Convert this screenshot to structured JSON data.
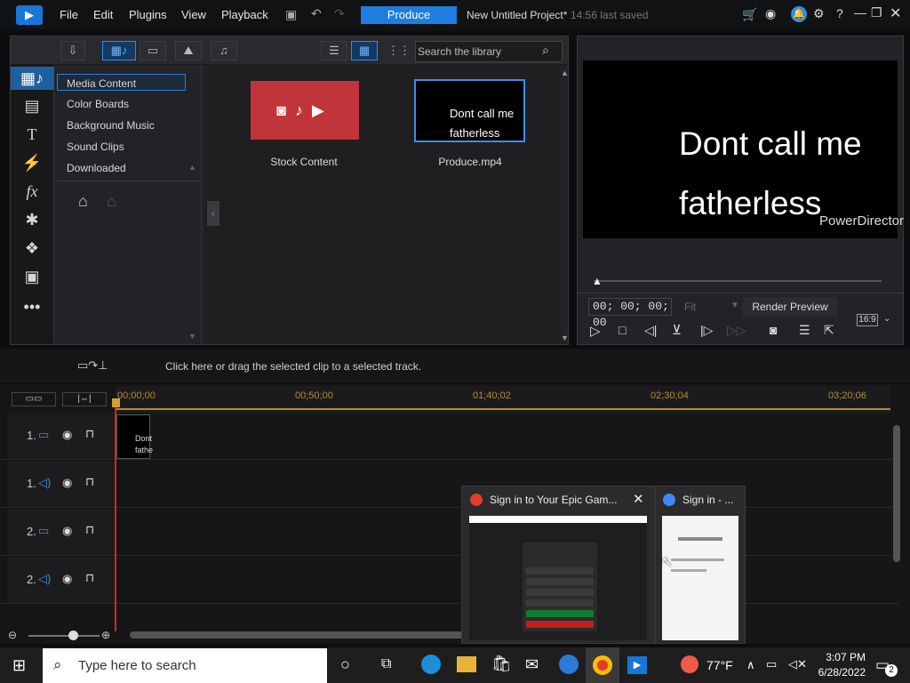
{
  "menu": {
    "file": "File",
    "edit": "Edit",
    "plugins": "Plugins",
    "view": "View",
    "playback": "Playback",
    "produce": "Produce",
    "project_title": "New Untitled Project*",
    "last_saved": "14:56 last saved"
  },
  "library": {
    "search_placeholder": "Search the library",
    "tree": [
      "Media Content",
      "Color Boards",
      "Background Music",
      "Sound Clips",
      "Downloaded"
    ],
    "items": [
      {
        "label": "Stock Content"
      },
      {
        "label": "Produce.mp4",
        "thumb_line1": "Dont call me",
        "thumb_line2": "fatherless"
      }
    ]
  },
  "preview": {
    "line1": "Dont call me",
    "line2": "fatherless",
    "watermark": "PowerDirector",
    "timecode": "00; 00; 00; 00",
    "fit": "Fit",
    "render_preview": "Render Preview",
    "aspect": "16:9"
  },
  "timeline": {
    "hint": "Click here or drag the selected clip to a selected track.",
    "ticks": [
      "00;00;00",
      "00;50;00",
      "01;40;02",
      "02;30;04",
      "03;20;06"
    ],
    "tracks": [
      "1.",
      "1.",
      "2.",
      "2."
    ],
    "clip_text": [
      "Dont",
      "fathe"
    ]
  },
  "popups": [
    {
      "title": "Sign in to Your Epic Gam..."
    },
    {
      "title": "Sign in - ..."
    }
  ],
  "taskbar": {
    "search": "Type here to search",
    "weather": "77°F",
    "time": "3:07 PM",
    "date": "6/28/2022",
    "notif": "2"
  },
  "colors": {
    "accent": "#1f7de0",
    "playhead": "#d42a2a",
    "stock_tile": "#c1353a"
  }
}
